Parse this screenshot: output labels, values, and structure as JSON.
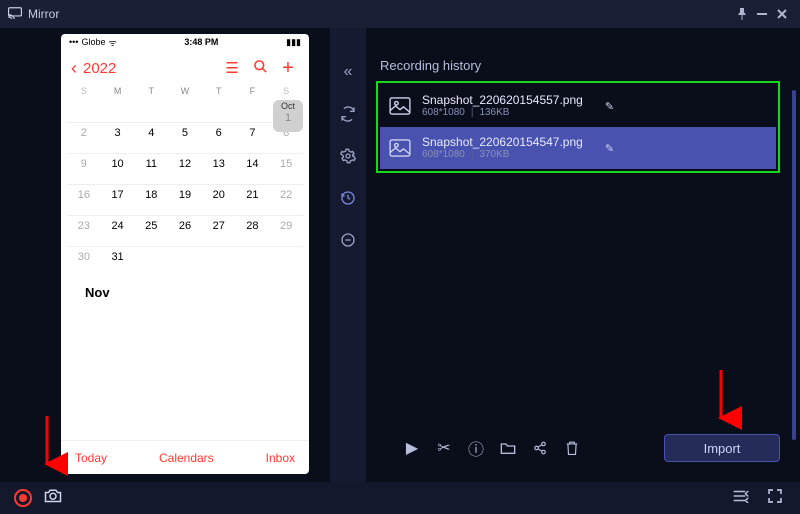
{
  "app": {
    "title": "Mirror"
  },
  "phone": {
    "status": {
      "carrier": "Globe",
      "time": "3:48 PM"
    },
    "year": "2022",
    "dow": [
      "S",
      "M",
      "T",
      "W",
      "T",
      "F",
      "S"
    ],
    "oct_label": "Oct",
    "oct_day": "1",
    "weeks": [
      [
        "2",
        "3",
        "4",
        "5",
        "6",
        "7",
        "8"
      ],
      [
        "9",
        "10",
        "11",
        "12",
        "13",
        "14",
        "15"
      ],
      [
        "16",
        "17",
        "18",
        "19",
        "20",
        "21",
        "22"
      ],
      [
        "23",
        "24",
        "25",
        "26",
        "27",
        "28",
        "29"
      ],
      [
        "30",
        "31",
        "",
        "",
        "",
        "",
        ""
      ]
    ],
    "nov_label": "Nov",
    "footer": {
      "today": "Today",
      "calendars": "Calendars",
      "inbox": "Inbox"
    }
  },
  "panel": {
    "title": "Recording history",
    "items": [
      {
        "name": "Snapshot_220620154557.png",
        "res": "608*1080",
        "size": "136KB"
      },
      {
        "name": "Snapshot_220620154547.png",
        "res": "608*1080",
        "size": "370KB"
      }
    ],
    "import_label": "Import"
  }
}
